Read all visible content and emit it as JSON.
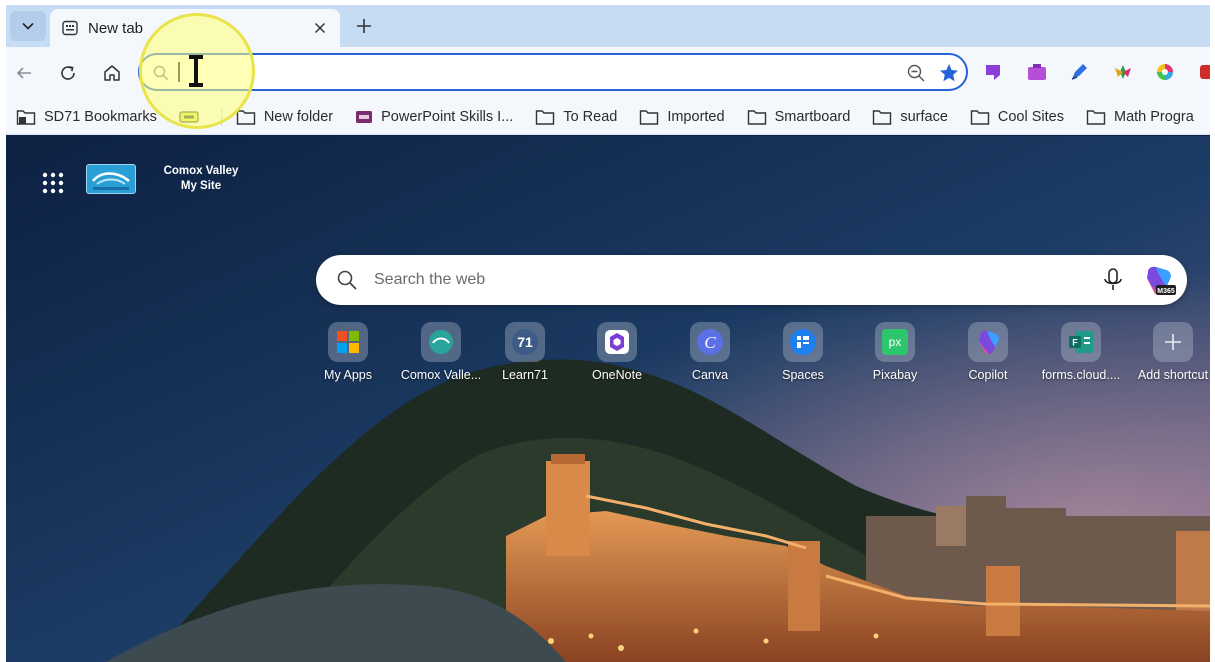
{
  "tab": {
    "title": "New tab"
  },
  "omnibox": {
    "value": "",
    "placeholder": ""
  },
  "bookmarks": [
    {
      "label": "SD71 Bookmarks",
      "icon": "bookmark-folder-icon"
    },
    {
      "label": "",
      "icon": "green-app-icon"
    },
    {
      "label": "New folder",
      "icon": "folder-icon"
    },
    {
      "label": "PowerPoint Skills I...",
      "icon": "powerpoint-icon"
    },
    {
      "label": "To Read",
      "icon": "folder-icon"
    },
    {
      "label": "Imported",
      "icon": "folder-icon"
    },
    {
      "label": "Smartboard",
      "icon": "folder-icon"
    },
    {
      "label": "surface",
      "icon": "folder-icon"
    },
    {
      "label": "Cool Sites",
      "icon": "folder-icon"
    },
    {
      "label": "Math Progra",
      "icon": "folder-icon"
    }
  ],
  "site": {
    "name_line1": "Comox Valley",
    "name_line2": "My Site"
  },
  "search": {
    "placeholder": "Search the web",
    "copilot_badge": "M365"
  },
  "shortcuts": [
    {
      "label": "My Apps",
      "icon": "microsoft-logo-icon"
    },
    {
      "label": "Comox Valle...",
      "icon": "comox-valley-icon"
    },
    {
      "label": "Learn71",
      "icon": "learn71-icon",
      "text": "71"
    },
    {
      "label": "OneNote",
      "icon": "onenote-icon"
    },
    {
      "label": "Canva",
      "icon": "canva-icon",
      "text": "C"
    },
    {
      "label": "Spaces",
      "icon": "spaces-icon"
    },
    {
      "label": "Pixabay",
      "icon": "pixabay-icon",
      "text": "px"
    },
    {
      "label": "Copilot",
      "icon": "copilot-icon"
    },
    {
      "label": "forms.cloud....",
      "icon": "forms-icon"
    },
    {
      "label": "Add shortcut",
      "icon": "plus-icon"
    }
  ],
  "colors": {
    "accent": "#2563d9",
    "tabstrip": "#c6dcf2",
    "toolbar": "#f4f8fd",
    "highlight": "#f7f36b"
  }
}
